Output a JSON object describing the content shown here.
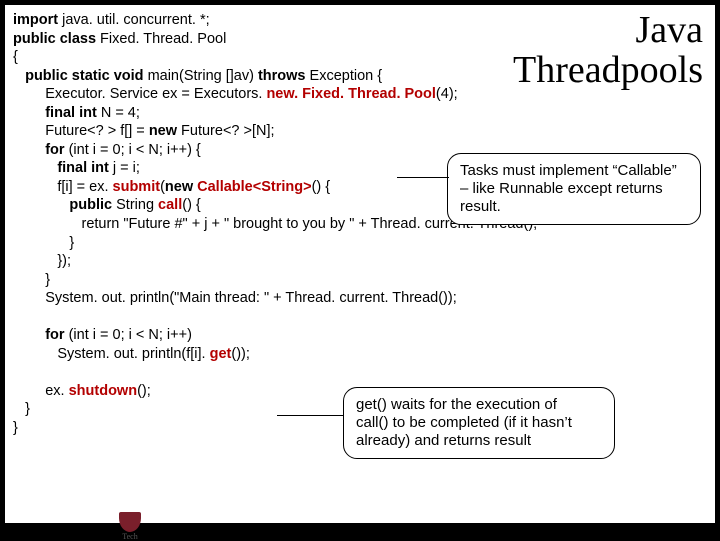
{
  "title_line1": "Java",
  "title_line2": "Threadpools",
  "code": {
    "l01a": "import ",
    "l01b": "java. util. concurrent. *;",
    "l02a": "public class ",
    "l02b": "Fixed. Thread. Pool",
    "l03": "{",
    "l04a": "   public static void ",
    "l04b": "main(String []av) ",
    "l04c": "throws ",
    "l04d": "Exception {",
    "l05a": "        Executor. Service ex = Executors. ",
    "l05b": "new. Fixed. Thread. Pool",
    "l05c": "(4);",
    "l06a": "        final int ",
    "l06b": "N = 4;",
    "l07a": "        Future<? > f[] = ",
    "l07b": "new ",
    "l07c": "Future<? >[N];",
    "l08a": "        for ",
    "l08b": "(int ",
    "l08c": "i = 0; i < N; i++) {",
    "l09a": "           final int ",
    "l09b": "j = i;",
    "l10a": "           f[i] = ex. ",
    "l10b": "submit",
    "l10c": "(",
    "l10d": "new ",
    "l10e": "Callable<String>",
    "l10f": "() {",
    "l11a": "              public ",
    "l11b": "String ",
    "l11c": "call",
    "l11d": "() {",
    "l12": "                 return \"Future #\" + j + \" brought to you by \" + Thread. current. Thread();",
    "l13": "              }",
    "l14": "           });",
    "l15": "        }",
    "l16": "        System. out. println(\"Main thread: \" + Thread. current. Thread());",
    "blank1": " ",
    "l17a": "        for ",
    "l17b": "(int ",
    "l17c": "i = 0; i < N; i++)",
    "l18a": "           System. out. println(f[i]. ",
    "l18b": "get",
    "l18c": "());",
    "blank2": " ",
    "l19a": "        ex. ",
    "l19b": "shutdown",
    "l19c": "();",
    "l20": "   }",
    "l21": "}"
  },
  "callout1_line1": "Tasks must implement “Callable”",
  "callout1_line2": "– like Runnable except returns",
  "callout1_line3": "result.",
  "callout2_line1": "get() waits for the execution of",
  "callout2_line2": "call() to be completed (if it hasn’t",
  "callout2_line3": "already) and returns result",
  "footer": "Tech"
}
